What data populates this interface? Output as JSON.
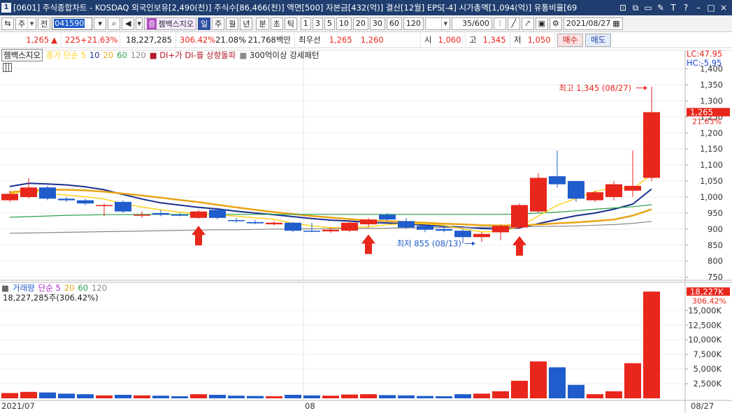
{
  "window": {
    "code": "1",
    "title": "[0601] 주식종합차트 - KOSDAQ 외국인보유[2,490(천)] 주식수[86,466(천)] 액면[500] 자본금[432(억)] 결산[12월] EPS[-4] 시가총액[1,094(억)] 유통비율[69",
    "buttons": [
      "⊡",
      "⧉",
      "▭",
      "✎",
      "T",
      "?",
      "–",
      "□",
      "×"
    ]
  },
  "toolbar": {
    "market": "주",
    "period_label": "전",
    "stock_code": "041590",
    "indicator_chip": "젬백스지오",
    "timeframes": [
      "일",
      "주",
      "월",
      "년",
      "분",
      "초",
      "틱"
    ],
    "active_timeframe": "일",
    "intervals": [
      "1",
      "3",
      "5",
      "10",
      "20",
      "30",
      "60",
      "120"
    ],
    "count": "35/600",
    "date": "2021/08/27"
  },
  "quote": {
    "price": "1,265",
    "change_arrow": "▲",
    "change": "225",
    "change_pct": "+21.63%",
    "volume": "18,227,285",
    "volume_ratio": "306.42%",
    "turnover": "21.08%",
    "amount": "21,768백만",
    "bid_label": "최우선",
    "bid1": "1,265",
    "bid2": "1,260",
    "open_label": "시",
    "open": "1,060",
    "high_label": "고",
    "high": "1,345",
    "low_label": "저",
    "low": "1,050",
    "buy_label": "매수",
    "sell_label": "매도"
  },
  "legend": {
    "stock": "젬백스지오",
    "ma_label": "종가 단순 5",
    "ma10": "10",
    "ma20": "20",
    "ma60": "60",
    "ma120": "120",
    "signal1": "DI+가 DI-를 상향돌파",
    "signal2": "300억이상 강세패턴"
  },
  "volume_legend": {
    "label": "거래량",
    "ma_label": "단순 5",
    "ma20": "20",
    "ma60": "60",
    "ma120": "120",
    "value": "18,227,285주(306.42%)"
  },
  "corner": {
    "lc": "LC:47.95",
    "hc": "HC:-5.95"
  },
  "annotations": {
    "high": "최고 1,345 (08/27)",
    "low": "최저 855 (08/13)"
  },
  "price_label": {
    "price": "1,265",
    "pct": "21.63%"
  },
  "volume_label": {
    "value": "18,227K",
    "pct": "306.42%"
  },
  "colors": {
    "up": "#e8261b",
    "down": "#1f5ccc",
    "ma5": "#ffd21e",
    "ma10": "#1a2e8f",
    "ma20": "#e8a418",
    "ma60": "#2aa04a",
    "ma120": "#888888"
  },
  "chart_data": {
    "type": "candlestick",
    "price_axis": {
      "min": 750,
      "max": 1400,
      "ticks": [
        "1,400",
        "1,350",
        "1,300",
        "1,250",
        "1,200",
        "1,150",
        "1,100",
        "1,050",
        "1,000",
        "950",
        "900",
        "850",
        "800",
        "750"
      ]
    },
    "volume_axis": {
      "unit": "K",
      "max": 17500,
      "ticks": [
        "15,000K",
        "12,500K",
        "10,000K",
        "7,500K",
        "5,000K",
        "2,500K"
      ]
    },
    "x_labels": [
      "2021/07",
      "08",
      "08/27"
    ],
    "candles": [
      {
        "o": 990,
        "h": 1020,
        "l": 985,
        "c": 1010,
        "v": 900
      },
      {
        "o": 1000,
        "h": 1060,
        "l": 995,
        "c": 1030,
        "v": 1100
      },
      {
        "o": 1030,
        "h": 1035,
        "l": 990,
        "c": 995,
        "v": 1000
      },
      {
        "o": 995,
        "h": 1000,
        "l": 985,
        "c": 990,
        "v": 800
      },
      {
        "o": 990,
        "h": 995,
        "l": 975,
        "c": 980,
        "v": 700
      },
      {
        "o": 975,
        "h": 980,
        "l": 940,
        "c": 975,
        "v": 500
      },
      {
        "o": 985,
        "h": 990,
        "l": 950,
        "c": 955,
        "v": 600
      },
      {
        "o": 945,
        "h": 955,
        "l": 935,
        "c": 945,
        "v": 500
      },
      {
        "o": 950,
        "h": 960,
        "l": 940,
        "c": 945,
        "v": 450
      },
      {
        "o": 945,
        "h": 950,
        "l": 940,
        "c": 942,
        "v": 350
      },
      {
        "o": 935,
        "h": 960,
        "l": 932,
        "c": 955,
        "v": 700
      },
      {
        "o": 960,
        "h": 962,
        "l": 930,
        "c": 935,
        "v": 600
      },
      {
        "o": 928,
        "h": 935,
        "l": 920,
        "c": 925,
        "v": 450
      },
      {
        "o": 922,
        "h": 928,
        "l": 915,
        "c": 918,
        "v": 400
      },
      {
        "o": 915,
        "h": 925,
        "l": 912,
        "c": 920,
        "v": 350
      },
      {
        "o": 920,
        "h": 922,
        "l": 890,
        "c": 895,
        "v": 600
      },
      {
        "o": 895,
        "h": 920,
        "l": 890,
        "c": 892,
        "v": 500
      },
      {
        "o": 893,
        "h": 905,
        "l": 888,
        "c": 898,
        "v": 450
      },
      {
        "o": 895,
        "h": 925,
        "l": 890,
        "c": 920,
        "v": 650
      },
      {
        "o": 915,
        "h": 935,
        "l": 905,
        "c": 930,
        "v": 700
      },
      {
        "o": 945,
        "h": 950,
        "l": 925,
        "c": 930,
        "v": 550
      },
      {
        "o": 925,
        "h": 935,
        "l": 900,
        "c": 905,
        "v": 500
      },
      {
        "o": 910,
        "h": 915,
        "l": 890,
        "c": 898,
        "v": 400
      },
      {
        "o": 900,
        "h": 910,
        "l": 890,
        "c": 895,
        "v": 350
      },
      {
        "o": 895,
        "h": 900,
        "l": 855,
        "c": 875,
        "v": 700
      },
      {
        "o": 875,
        "h": 890,
        "l": 860,
        "c": 885,
        "v": 800
      },
      {
        "o": 890,
        "h": 915,
        "l": 865,
        "c": 910,
        "v": 1200
      },
      {
        "o": 905,
        "h": 980,
        "l": 900,
        "c": 975,
        "v": 3000
      },
      {
        "o": 955,
        "h": 1075,
        "l": 950,
        "c": 1060,
        "v": 6300
      },
      {
        "o": 1065,
        "h": 1145,
        "l": 1030,
        "c": 1040,
        "v": 5300
      },
      {
        "o": 1050,
        "h": 1050,
        "l": 985,
        "c": 995,
        "v": 2300
      },
      {
        "o": 990,
        "h": 1020,
        "l": 985,
        "c": 1015,
        "v": 700
      },
      {
        "o": 1000,
        "h": 1050,
        "l": 990,
        "c": 1040,
        "v": 1200
      },
      {
        "o": 1020,
        "h": 1145,
        "l": 1000,
        "c": 1035,
        "v": 6000
      },
      {
        "o": 1060,
        "h": 1345,
        "l": 1050,
        "c": 1265,
        "v": 18227
      }
    ],
    "series": [
      {
        "name": "10",
        "values": [
          1033,
          1043,
          1041,
          1038,
          1032,
          1023,
          1008,
          994,
          982,
          975,
          968,
          963,
          956,
          950,
          945,
          939,
          933,
          928,
          925,
          921,
          919,
          916,
          912,
          909,
          906,
          902,
          900,
          904,
          917,
          930,
          942,
          950,
          962,
          978,
          1025
        ]
      },
      {
        "name": "20",
        "values": [
          1015,
          1020,
          1023,
          1023,
          1021,
          1017,
          1011,
          1005,
          998,
          991,
          984,
          976,
          968,
          960,
          953,
          947,
          941,
          936,
          931,
          927,
          925,
          922,
          920,
          917,
          915,
          912,
          911,
          912,
          914,
          918,
          921,
          925,
          930,
          942,
          962
        ]
      },
      {
        "name": "60",
        "values": [
          937,
          939,
          941,
          943,
          944,
          945,
          945,
          946,
          946,
          946,
          946,
          946,
          946,
          946,
          946,
          946,
          946,
          946,
          946,
          946,
          946,
          946,
          946,
          946,
          946,
          946,
          946,
          947,
          950,
          953,
          957,
          962,
          966,
          970,
          976
        ]
      },
      {
        "name": "120",
        "values": [
          887,
          888,
          889,
          890,
          891,
          892,
          893,
          894,
          895,
          896,
          897,
          898,
          898,
          899,
          900,
          900,
          901,
          901,
          902,
          902,
          903,
          904,
          904,
          905,
          905,
          906,
          906,
          907,
          908,
          909,
          910,
          912,
          914,
          918,
          924
        ]
      }
    ],
    "signal_arrows_at": [
      10,
      19,
      27
    ]
  }
}
